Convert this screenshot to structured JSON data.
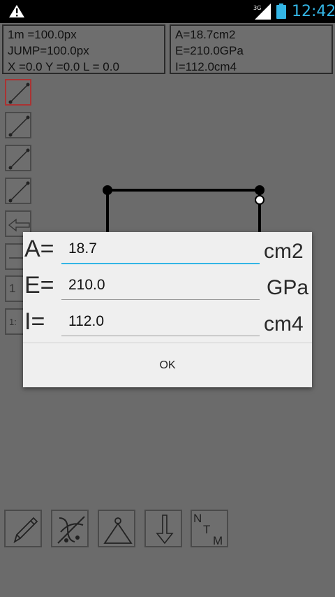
{
  "status_bar": {
    "time": "12:42",
    "network": "3G",
    "icons": [
      "warning-icon",
      "signal-icon",
      "battery-icon"
    ],
    "clock_color": "#33b5e5"
  },
  "info_left": {
    "scale": "1m =100.0px",
    "jump": "JUMP=100.0px",
    "coords": "X =0.0 Y =0.0 L = 0.0"
  },
  "info_right": {
    "area": "A=18.7cm2",
    "modulus": "E=210.0GPa",
    "inertia": "I=112.0cm4"
  },
  "tools": [
    {
      "icon": "line-tool-icon",
      "selected": true
    },
    {
      "icon": "line-tool-icon"
    },
    {
      "icon": "line-tool-icon"
    },
    {
      "icon": "line-tool-icon"
    },
    {
      "icon": "back-arrow-icon"
    },
    {
      "icon": "ratio-icon",
      "text": "1"
    },
    {
      "icon": "scale-ratio-icon",
      "text": "1:"
    }
  ],
  "bottom_toolbar": [
    {
      "icon": "pencil-icon"
    },
    {
      "icon": "delete-icon"
    },
    {
      "icon": "support-icon"
    },
    {
      "icon": "load-arrow-down-icon"
    },
    {
      "icon": "ntm-diagram-icon",
      "text": [
        "N",
        "T",
        "M"
      ]
    }
  ],
  "dialog": {
    "fields": [
      {
        "label": "A=",
        "value": "18.7",
        "unit": "cm2",
        "focused": true
      },
      {
        "label": "E=",
        "value": "210.0",
        "unit": "GPa",
        "focused": false
      },
      {
        "label": "I=",
        "value": "112.0",
        "unit": "cm4",
        "focused": false
      }
    ],
    "ok_label": "OK"
  }
}
